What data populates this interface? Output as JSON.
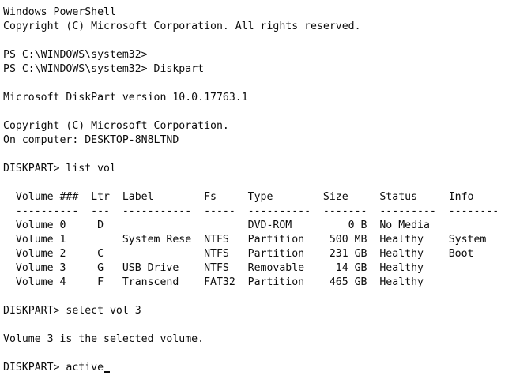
{
  "terminal": {
    "lines": [
      "Windows PowerShell",
      "Copyright (C) Microsoft Corporation. All rights reserved.",
      "",
      "PS C:\\WINDOWS\\system32>",
      "PS C:\\WINDOWS\\system32> Diskpart",
      "",
      "Microsoft DiskPart version 10.0.17763.1",
      "",
      "Copyright (C) Microsoft Corporation.",
      "On computer: DESKTOP-8N8LTND",
      "",
      "DISKPART> list vol",
      "",
      "  Volume ###  Ltr  Label        Fs     Type        Size     Status     Info",
      "  ----------  ---  -----------  -----  ----------  -------  ---------  --------",
      "  Volume 0     D                       DVD-ROM         0 B  No Media",
      "  Volume 1         System Rese  NTFS   Partition    500 MB  Healthy    System",
      "  Volume 2     C                NTFS   Partition    231 GB  Healthy    Boot",
      "  Volume 3     G   USB Drive    NTFS   Removable     14 GB  Healthy",
      "  Volume 4     F   Transcend    FAT32  Partition    465 GB  Healthy",
      "",
      "DISKPART> select vol 3",
      "",
      "Volume 3 is the selected volume.",
      "",
      "DISKPART> active"
    ]
  }
}
